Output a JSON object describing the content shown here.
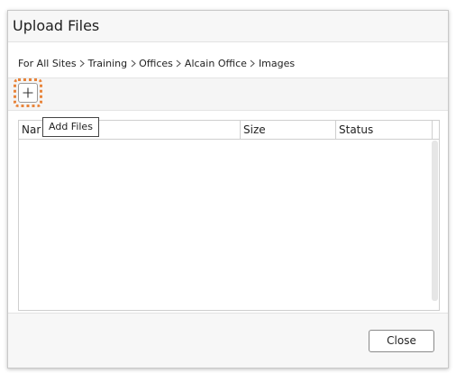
{
  "dialog": {
    "title": "Upload Files"
  },
  "breadcrumb": {
    "items": [
      "For All Sites",
      "Training",
      "Offices",
      "Alcain Office",
      "Images"
    ]
  },
  "toolbar": {
    "add_button_icon": "plus-icon",
    "add_tooltip": "Add Files"
  },
  "table": {
    "columns": [
      "Name",
      "Size",
      "Status"
    ],
    "name_visible": "Nar"
  },
  "footer": {
    "close_label": "Close"
  },
  "colors": {
    "focus_ring": "#e8843a",
    "border": "#cfcfcf",
    "panel_bg": "#f7f7f7"
  }
}
